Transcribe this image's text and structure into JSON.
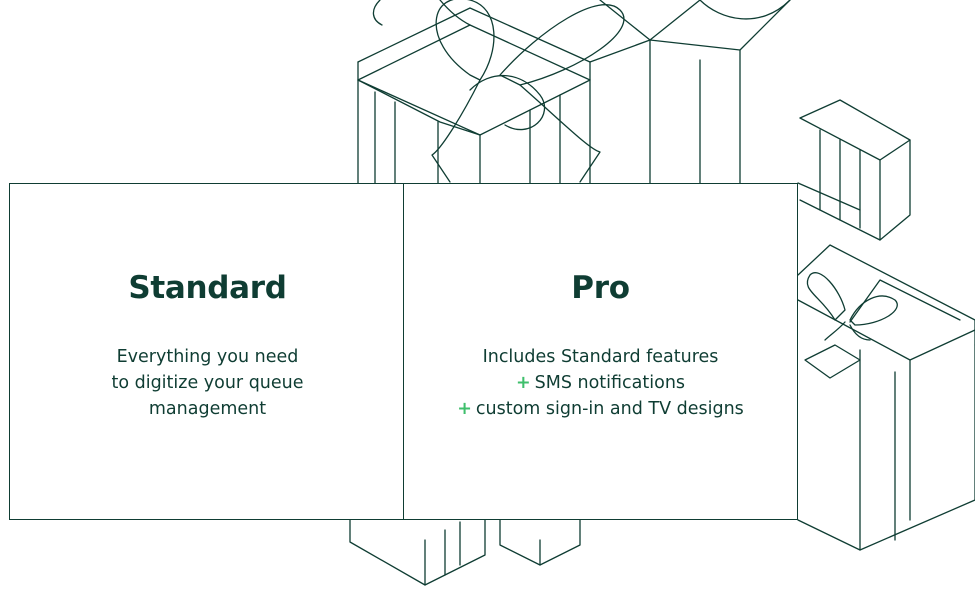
{
  "colors": {
    "ink": "#0f3d33",
    "plus_accent": "#3fbf6c",
    "background": "#ffffff"
  },
  "illustration": {
    "icon": "gift-boxes-line-art"
  },
  "plans": {
    "standard": {
      "title": "Standard",
      "lines": [
        "Everything you need",
        "to digitize your queue",
        "management"
      ]
    },
    "pro": {
      "title": "Pro",
      "intro": "Includes Standard features",
      "plus_symbol": "+",
      "features": [
        "SMS notifications",
        "custom sign-in and TV designs"
      ]
    }
  }
}
